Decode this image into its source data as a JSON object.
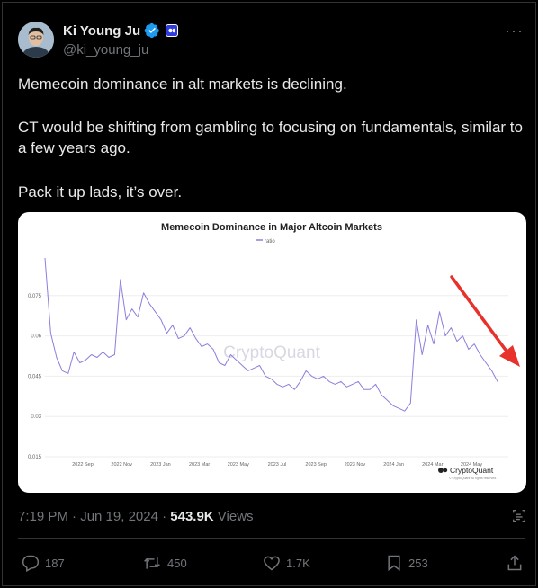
{
  "author": {
    "name": "Ki Young Ju",
    "handle": "@ki_young_ju"
  },
  "tweet": {
    "paragraphs": [
      "Memecoin dominance in alt markets is declining.",
      "CT would be shifting from gambling to focusing on fundamentals, similar to a few years ago.",
      "Pack it up lads, it’s over."
    ]
  },
  "meta": {
    "timestamp": "7:19 PM · Jun 19, 2024 · ",
    "views_count": "543.9K",
    "views_label": " Views"
  },
  "actions": {
    "replies": "187",
    "reposts": "450",
    "likes": "1.7K",
    "bookmarks": "253"
  },
  "icons": [
    "verified-badge-icon",
    "org-badge-icon",
    "more-icon",
    "grok-icon",
    "reply-icon",
    "repost-icon",
    "like-icon",
    "bookmark-icon",
    "share-icon"
  ],
  "colors": {
    "accent": "#1d9bf0",
    "line": "#8a7fdc",
    "arrow": "#e8312a"
  },
  "chart_data": {
    "type": "line",
    "title": "Memecoin Dominance in Major Altcoin Markets",
    "legend": [
      "ratio"
    ],
    "watermark": "CryptoQuant",
    "brand": "CryptoQuant",
    "copyright": "© CryptoQuant All rights reserved.",
    "y_ticks": [
      "0.075",
      "0.06",
      "0.045",
      "0.03",
      "0.015"
    ],
    "x_ticks": [
      "2022 Sep",
      "2022 Nov",
      "2023 Jan",
      "2023 Mar",
      "2023 May",
      "2023 Jul",
      "2023 Sep",
      "2023 Nov",
      "2024 Jan",
      "2024 Mar",
      "2024 May"
    ],
    "ylim": [
      0.015,
      0.09
    ],
    "xlim": [
      "2022 Jul",
      "2024 Jun"
    ],
    "grid": true,
    "series": [
      {
        "name": "ratio",
        "values": [
          0.089,
          0.061,
          0.052,
          0.047,
          0.046,
          0.054,
          0.05,
          0.051,
          0.053,
          0.052,
          0.054,
          0.052,
          0.053,
          0.081,
          0.066,
          0.07,
          0.067,
          0.076,
          0.072,
          0.069,
          0.066,
          0.061,
          0.064,
          0.059,
          0.06,
          0.063,
          0.059,
          0.056,
          0.057,
          0.055,
          0.05,
          0.049,
          0.053,
          0.051,
          0.049,
          0.047,
          0.048,
          0.049,
          0.045,
          0.044,
          0.042,
          0.041,
          0.042,
          0.04,
          0.043,
          0.047,
          0.045,
          0.044,
          0.045,
          0.043,
          0.042,
          0.043,
          0.041,
          0.042,
          0.043,
          0.04,
          0.04,
          0.042,
          0.038,
          0.036,
          0.034,
          0.033,
          0.032,
          0.035,
          0.066,
          0.053,
          0.064,
          0.057,
          0.069,
          0.06,
          0.063,
          0.058,
          0.06,
          0.055,
          0.057,
          0.053,
          0.05,
          0.047,
          0.043
        ]
      }
    ]
  }
}
